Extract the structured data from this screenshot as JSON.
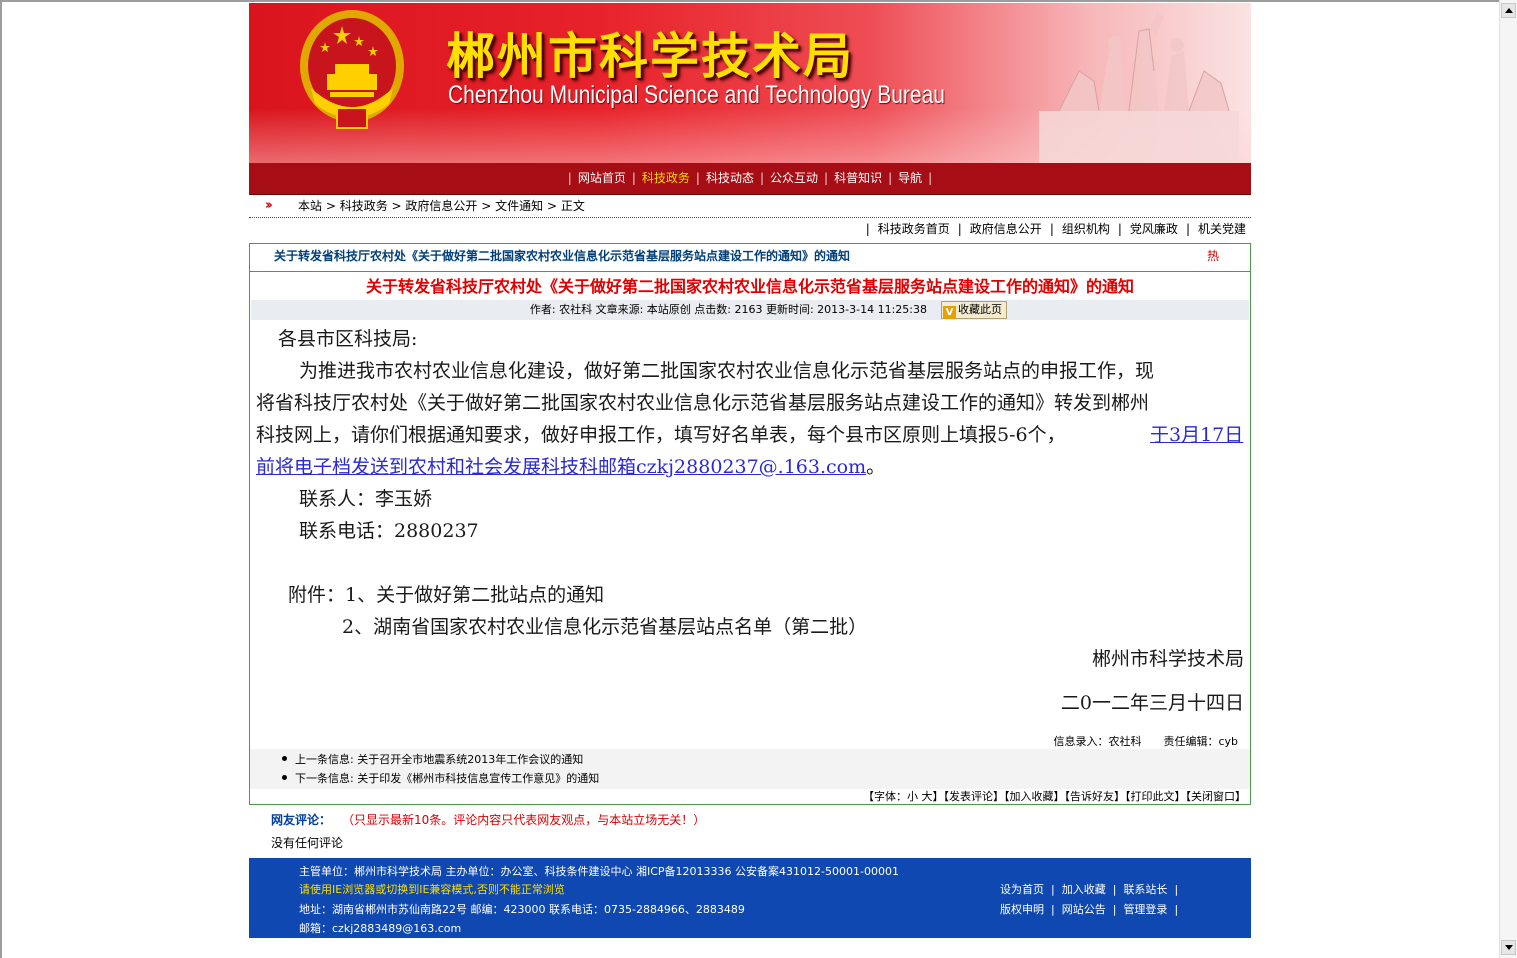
{
  "banner": {
    "title_cn": "郴州市科学技术局",
    "title_en": "Chenzhou Municipal  Science and Technology Bureau"
  },
  "nav": {
    "items": [
      "网站首页",
      "科技政务",
      "科技动态",
      "公众互动",
      "科普知识",
      "导航"
    ],
    "active": "科技政务"
  },
  "breadcrumb": {
    "items": [
      "本站",
      "科技政务",
      "政府信息公开",
      "文件通知",
      "正文"
    ]
  },
  "subnav": {
    "items": [
      "科技政务首页",
      "政府信息公开",
      "组织机构",
      "党风廉政",
      "机关党建"
    ]
  },
  "article": {
    "header_title": "关于转发省科技厅农村处《关于做好第二批国家农村农业信息化示范省基层服务站点建设工作的通知》的通知",
    "hot_label": "热",
    "title": "关于转发省科技厅农村处《关于做好第二批国家农村农业信息化示范省基层服务站点建设工作的通知》的通知",
    "meta": "作者: 农社科 文章来源: 本站原创 点击数: 2163 更新时间: 2013-3-14 11:25:38",
    "favorite_label": "收藏此页",
    "salutation": "各县市区科技局:",
    "para1_line1": "为推进我市农村农业信息化建设，做好第二批国家农村农业信息化示范省基层服务站点的申报工作，现",
    "para1_line2": "将省科技厅农村处《关于做好第二批国家农村农业信息化示范省基层服务站点建设工作的通知》转发到郴州",
    "para1_line3_text": "科技网上，请你们根据通知要求，做好申报工作，填写好名单表，每个县市区原则上填报5-6个，",
    "para1_line3_link": "于3月17日",
    "para1_line4_link": "前将电子档发送到农村和社会发展科技科邮箱czkj2880237@.163.com",
    "para1_line4_end": "。",
    "contact": "联系人：李玉娇",
    "phone": "联系电话：2880237",
    "attachment1": "附件：1、关于做好第二批站点的通知",
    "attachment2": "2、湖南省国家农村农业信息化示范省基层站点名单（第二批）",
    "signature_org": "郴州市科学技术局",
    "signature_date": "二0一二年三月十四日",
    "entered_by": "信息录入：农社科",
    "editor": "责任编辑：cyb",
    "prev": "上一条信息:  关于召开全市地震系统2013年工作会议的通知",
    "next": "下一条信息:  关于印发《郴州市科技信息宣传工作意见》的通知",
    "tools": "【字体：小 大】【发表评论】【加入收藏】【告诉好友】【打印此文】【关闭窗口】"
  },
  "comments": {
    "heading": "网友评论：",
    "note": "（只显示最新10条。评论内容只代表网友观点，与本站立场无关！）",
    "empty": "没有任何评论"
  },
  "footer": {
    "line1": "主管单位：郴州市科学技术局 主办单位：办公室、科技条件建设中心 湘ICP备12013336 公安备案431012-50001-00001",
    "line2": "请使用IE浏览器或切换到IE兼容模式,否则不能正常浏览",
    "line3": "地址：湖南省郴州市苏仙南路22号 邮编：423000 联系电话：0735-2884966、2883489",
    "line4": "邮箱：czkj2883489@163.com",
    "links_row1": [
      "设为首页",
      "加入收藏",
      "联系站长"
    ],
    "links_row2": [
      "版权申明",
      "网站公告",
      "管理登录"
    ]
  },
  "colors": {
    "banner_red": "#e8222a",
    "nav_bg": "#a70d14",
    "title_red": "#e00000",
    "footer_blue": "#0e48b0",
    "box_border": "#4a9a4a"
  }
}
